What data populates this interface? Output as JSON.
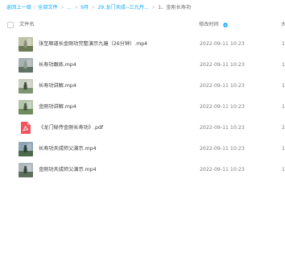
{
  "breadcrumb": {
    "back": "返回上一级",
    "sep": "|",
    "root": "全部文件",
    "ellipsis": "...",
    "folder1": "9月",
    "folder2": "29.龙门天成--三九丹...",
    "current": "1、金刚长寿功",
    "arrow": ">"
  },
  "header": {
    "filename": "文件名",
    "modified": "修改时间",
    "size": "大"
  },
  "files": [
    {
      "name": "张至顺道长金刚功完整演示九遍（26分钟）.mp4",
      "time": "2022-09-11 10:23",
      "size": "1",
      "icon": "video-thumbnail"
    },
    {
      "name": "长寿功跟练.mp4",
      "time": "2022-09-11 10:23",
      "size": "1",
      "icon": "video-thumbnail"
    },
    {
      "name": "长寿功讲解.mp4",
      "time": "2022-09-11 10:23",
      "size": "1",
      "icon": "video-thumbnail"
    },
    {
      "name": "金刚功讲解.mp4",
      "time": "2022-09-11 10:23",
      "size": "1",
      "icon": "video-thumbnail"
    },
    {
      "name": "《龙门秘传金刚长寿功》.pdf",
      "time": "2022-09-11 10:23",
      "size": "2",
      "icon": "pdf-icon"
    },
    {
      "name": "长寿功天成师父演示.mp4",
      "time": "2022-09-11 10:23",
      "size": "1",
      "icon": "video-thumbnail"
    },
    {
      "name": "金刚功天成师父演示.mp4",
      "time": "2022-09-11 10:23",
      "size": "1",
      "icon": "video-thumbnail"
    }
  ],
  "colors": {
    "link": "#09aaff",
    "pdf": "#f0555f"
  }
}
